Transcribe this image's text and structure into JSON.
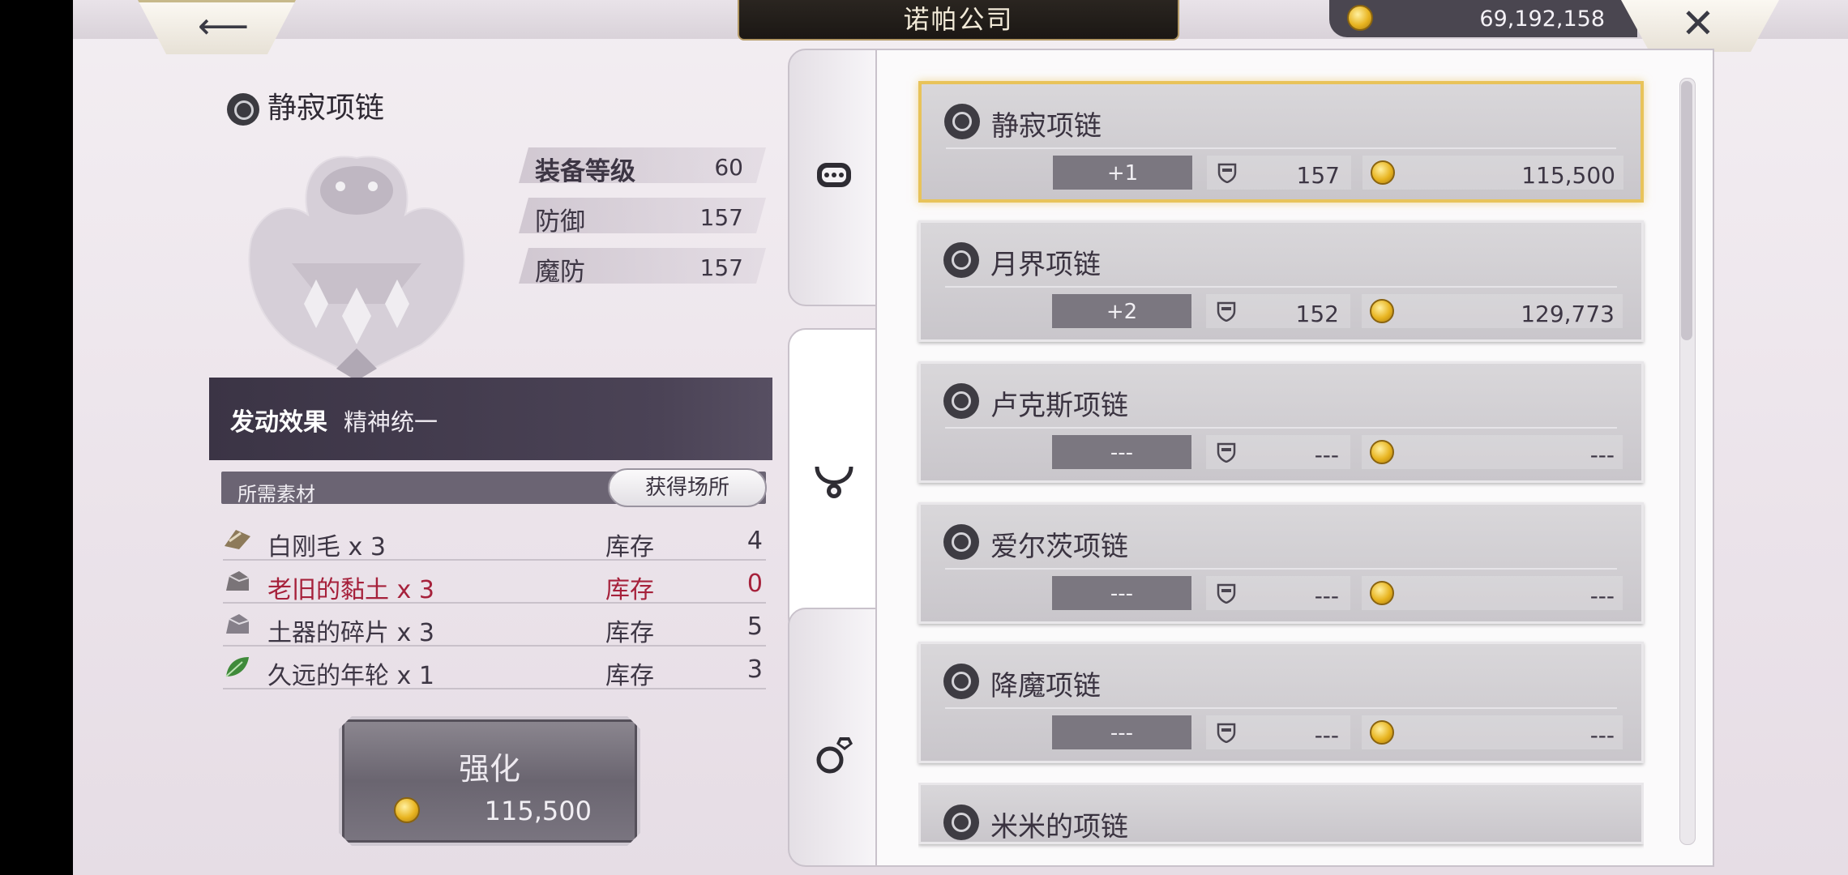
{
  "header": {
    "title": "诺帕公司",
    "coins": "69,192,158",
    "back_icon": "back-arrow-icon",
    "close_icon": "close-icon"
  },
  "item": {
    "name": "静寂项链",
    "stats": [
      {
        "label": "装备等级",
        "value": "60"
      },
      {
        "label": "防御",
        "value": "157"
      },
      {
        "label": "魔防",
        "value": "157"
      }
    ],
    "effect_label": "发动效果",
    "effect_value": "精神统一"
  },
  "materials": {
    "header": "所需素材",
    "obtain_button": "获得场所",
    "rows": [
      {
        "name": "白刚毛 x 3",
        "inv_label": "库存",
        "count": "4",
        "icon": "fur-icon"
      },
      {
        "name": "老旧的黏土 x 3",
        "inv_label": "库存",
        "count": "0",
        "icon": "clay-icon"
      },
      {
        "name": "土器的碎片 x 3",
        "inv_label": "库存",
        "count": "5",
        "icon": "shard-icon"
      },
      {
        "name": "久远的年轮 x 1",
        "inv_label": "库存",
        "count": "3",
        "icon": "leaf-icon"
      }
    ]
  },
  "enhance": {
    "label": "强化",
    "cost": "115,500"
  },
  "tabs": [
    {
      "icon": "bracelet-icon"
    },
    {
      "icon": "necklace-icon"
    },
    {
      "icon": "ring-icon"
    }
  ],
  "list": [
    {
      "name": "静寂项链",
      "level": "+1",
      "def": "157",
      "cost": "115,500"
    },
    {
      "name": "月界项链",
      "level": "+2",
      "def": "152",
      "cost": "129,773"
    },
    {
      "name": "卢克斯项链",
      "level": "---",
      "def": "---",
      "cost": "---"
    },
    {
      "name": "爱尔茨项链",
      "level": "---",
      "def": "---",
      "cost": "---"
    },
    {
      "name": "降魔项链",
      "level": "---",
      "def": "---",
      "cost": "---"
    },
    {
      "name": "米米的项链",
      "level": "",
      "def": "",
      "cost": ""
    }
  ],
  "colors": {
    "accent_gold": "#e8c35a",
    "shortage_red": "#a6213b",
    "dark_panel": "#3b3445"
  }
}
